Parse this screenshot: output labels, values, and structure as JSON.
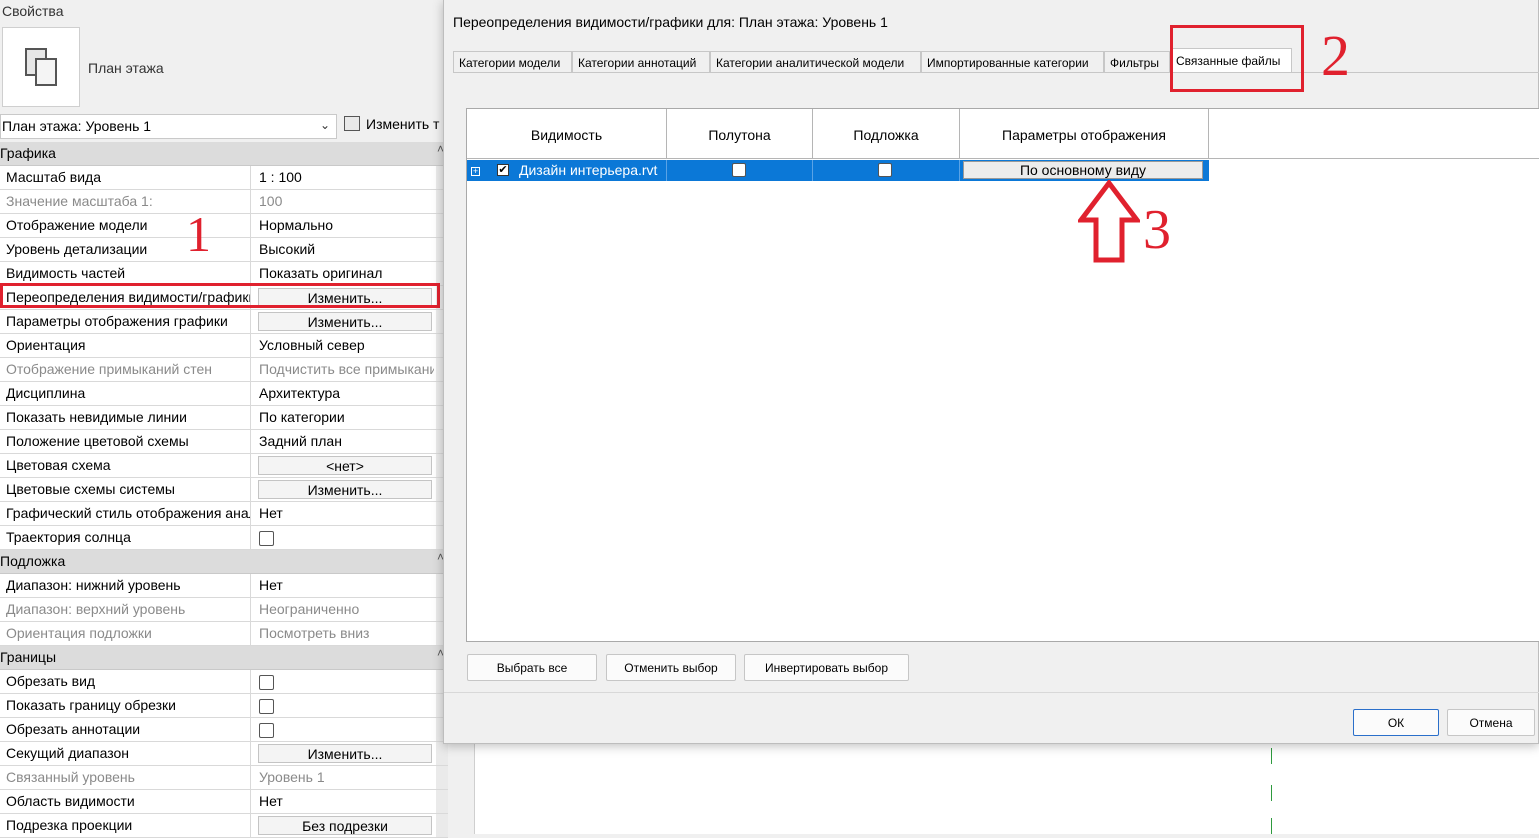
{
  "properties": {
    "title": "Свойства",
    "type_name": "План этажа",
    "view_selector": "План этажа: Уровень 1",
    "edit_type_label": "Изменить т",
    "groups": [
      {
        "name": "Графика",
        "rows": [
          {
            "label": "Масштаб вида",
            "value": "1 : 100",
            "kind": "text"
          },
          {
            "label": "Значение масштаба    1:",
            "value": "100",
            "kind": "text",
            "disabled": true
          },
          {
            "label": "Отображение модели",
            "value": "Нормально",
            "kind": "text"
          },
          {
            "label": "Уровень детализации",
            "value": "Высокий",
            "kind": "text"
          },
          {
            "label": "Видимость частей",
            "value": "Показать оригинал",
            "kind": "text"
          },
          {
            "label": "Переопределения видимости/графики",
            "value": "Изменить...",
            "kind": "button"
          },
          {
            "label": "Параметры отображения графики",
            "value": "Изменить...",
            "kind": "button"
          },
          {
            "label": "Ориентация",
            "value": "Условный север",
            "kind": "text"
          },
          {
            "label": "Отображение примыканий стен",
            "value": "Подчистить все примыкания",
            "kind": "text",
            "disabled": true
          },
          {
            "label": "Дисциплина",
            "value": "Архитектура",
            "kind": "text"
          },
          {
            "label": "Показать невидимые линии",
            "value": "По категории",
            "kind": "text"
          },
          {
            "label": "Положение цветовой схемы",
            "value": "Задний план",
            "kind": "text"
          },
          {
            "label": "Цветовая схема",
            "value": "<нет>",
            "kind": "button"
          },
          {
            "label": "Цветовые схемы системы",
            "value": "Изменить...",
            "kind": "button"
          },
          {
            "label": "Графический стиль отображения анализа",
            "value": "Нет",
            "kind": "text"
          },
          {
            "label": "Траектория солнца",
            "value": "",
            "kind": "check"
          }
        ]
      },
      {
        "name": "Подложка",
        "rows": [
          {
            "label": "Диапазон: нижний уровень",
            "value": "Нет",
            "kind": "text"
          },
          {
            "label": "Диапазон: верхний уровень",
            "value": "Неограниченно",
            "kind": "text",
            "disabled": true
          },
          {
            "label": "Ориентация подложки",
            "value": "Посмотреть вниз",
            "kind": "text",
            "disabled": true
          }
        ]
      },
      {
        "name": "Границы",
        "rows": [
          {
            "label": "Обрезать вид",
            "value": "",
            "kind": "check"
          },
          {
            "label": "Показать границу обрезки",
            "value": "",
            "kind": "check"
          },
          {
            "label": "Обрезать аннотации",
            "value": "",
            "kind": "check"
          },
          {
            "label": "Секущий диапазон",
            "value": "Изменить...",
            "kind": "button"
          },
          {
            "label": "Связанный уровень",
            "value": "Уровень 1",
            "kind": "text",
            "disabled": true
          },
          {
            "label": "Область видимости",
            "value": "Нет",
            "kind": "text"
          },
          {
            "label": "Подрезка проекции",
            "value": "Без подрезки",
            "kind": "button"
          }
        ]
      }
    ]
  },
  "annotations": {
    "n1": "1",
    "n2": "2",
    "n3": "3"
  },
  "dialog": {
    "title": "Переопределения видимости/графики для: План этажа: Уровень 1",
    "tabs": [
      "Категории модели",
      "Категории аннотаций",
      "Категории аналитической модели",
      "Импортированные категории",
      "Фильтры",
      "Связанные файлы"
    ],
    "active_tab": "Связанные файлы",
    "columns": [
      "Видимость",
      "Полутона",
      "Подложка",
      "Параметры отображения"
    ],
    "row": {
      "name": "Дизайн интерьера.rvt",
      "visible": true,
      "halftone": false,
      "underlay": false,
      "display": "По основному виду"
    },
    "buttons": {
      "select_all": "Выбрать все",
      "deselect": "Отменить выбор",
      "invert": "Инвертировать выбор",
      "ok": "ОК",
      "cancel": "Отмена"
    }
  },
  "colors": {
    "highlight": "#e0212e",
    "selection": "#0b78d7"
  }
}
